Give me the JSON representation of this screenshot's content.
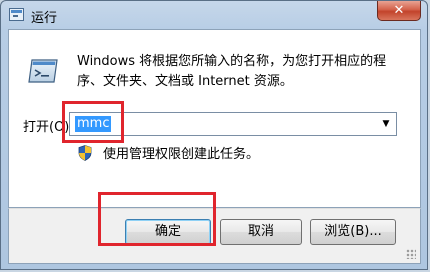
{
  "window": {
    "title": "运行",
    "close_glyph": "✕"
  },
  "icon": "run-program-icon",
  "description": "Windows 将根据您所输入的名称，为您打开相应的程序、文件夹、文档或 Internet 资源。",
  "open": {
    "label": "打开(O):",
    "value": "mmc"
  },
  "admin_note": "使用管理权限创建此任务。",
  "buttons": {
    "ok": "确定",
    "cancel": "取消",
    "browse": "浏览(B)..."
  },
  "colors": {
    "highlight": "#e0252d",
    "selection": "#3399ff"
  }
}
